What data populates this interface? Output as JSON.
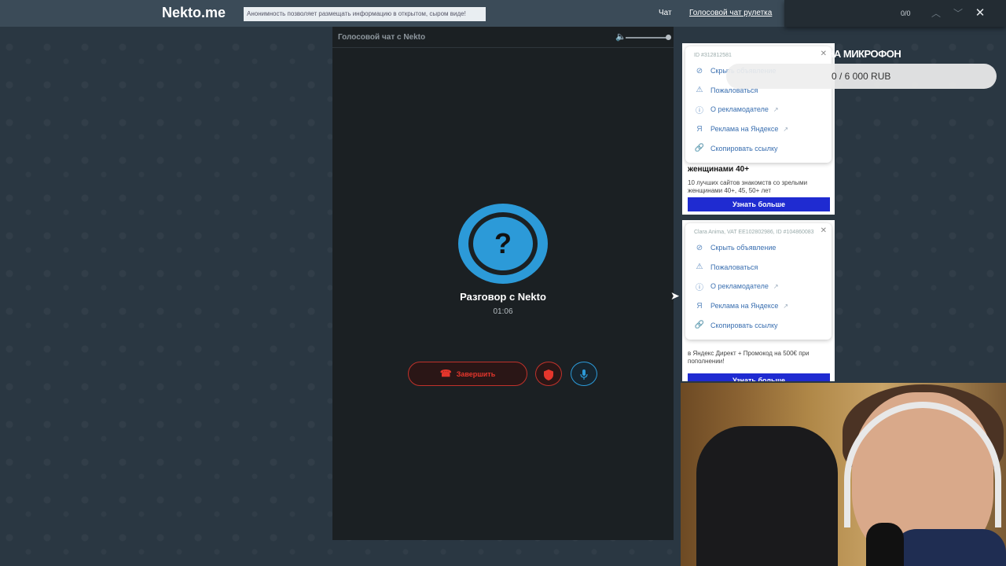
{
  "navbar": {
    "logo": "Nekto.me",
    "notice": "Анонимность позволяет размещать информацию в открытом, сыром виде!",
    "links": [
      "Чат",
      "Голосовой чат рулетка"
    ]
  },
  "findbar": {
    "count": "0/0",
    "icons": [
      "chevron-up-icon",
      "chevron-down-icon",
      "close-icon"
    ]
  },
  "panel": {
    "title": "Голосовой чат с Nekto",
    "volume_level": 1.0
  },
  "call": {
    "avatar_symbol": "?",
    "name": "Разговор с Nekto",
    "timer": "01:06",
    "end_label": "Завершить",
    "buttons": [
      "end-call",
      "report-shield",
      "microphone"
    ]
  },
  "ads": [
    {
      "id": "ID #312812581",
      "menu": [
        "Скрыть объявление",
        "Пожаловаться",
        "О рекламодателе",
        "Реклама на Яндексе",
        "Скопировать ссылку"
      ],
      "headline": "женщинами 40+",
      "description": "10 лучших сайтов знакомств со зрелыми женщинами 40+, 45, 50+ лет",
      "cta": "Узнать больше"
    },
    {
      "id": "Clara Anima, VAT EE102802986, ID #104860083",
      "menu": [
        "Скрыть объявление",
        "Пожаловаться",
        "О рекламодателе",
        "Реклама на Яндексе",
        "Скопировать ссылку"
      ],
      "description": "в Яндекс Директ + Промокод на 500€ при пополнении!",
      "cta": "Узнать больше"
    }
  ],
  "donation": {
    "title": "НА МИКРОФОН",
    "progress": "0 / 6 000 RUB"
  },
  "colors": {
    "accent_blue": "#2c9ad8",
    "danger_red": "#e5362c",
    "navbar": "#3b4b58",
    "panel": "#1b2023",
    "cta_blue": "#1f2bd1"
  }
}
